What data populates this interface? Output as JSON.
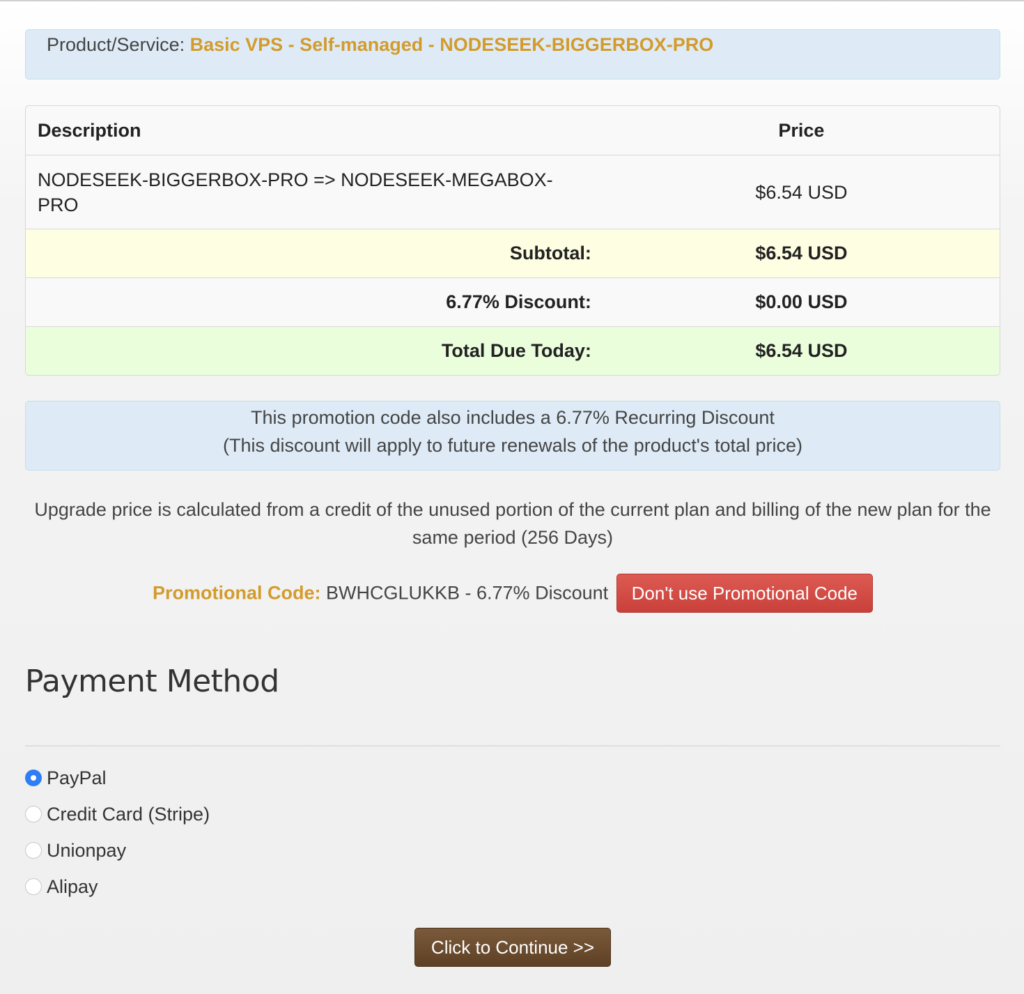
{
  "product": {
    "label": "Product/Service:",
    "name": "Basic VPS - Self-managed - NODESEEK-BIGGERBOX-PRO"
  },
  "summary": {
    "headers": {
      "description": "Description",
      "price": "Price"
    },
    "item": {
      "description": "NODESEEK-BIGGERBOX-PRO => NODESEEK-MEGABOX-PRO",
      "price": "$6.54 USD"
    },
    "subtotal": {
      "label": "Subtotal:",
      "value": "$6.54 USD"
    },
    "discount": {
      "label": "6.77% Discount:",
      "value": "$0.00 USD"
    },
    "total": {
      "label": "Total Due Today:",
      "value": "$6.54 USD"
    }
  },
  "promo_info": {
    "line1": "This promotion code also includes a 6.77% Recurring Discount",
    "line2": "(This discount will apply to future renewals of the product's total price)"
  },
  "upgrade_note": "Upgrade price is calculated from a credit of the unused portion of the current plan and billing of the new plan for the same period (256 Days)",
  "promo_code": {
    "label": "Promotional Code:",
    "value": "BWHCGLUKKB - 6.77% Discount",
    "remove_button": "Don't use Promotional Code"
  },
  "payment": {
    "title": "Payment Method",
    "methods": [
      {
        "label": "PayPal",
        "selected": true
      },
      {
        "label": "Credit Card (Stripe)",
        "selected": false
      },
      {
        "label": "Unionpay",
        "selected": false
      },
      {
        "label": "Alipay",
        "selected": false
      }
    ]
  },
  "continue_button": "Click to Continue >>",
  "colors": {
    "accent_orange": "#d39b2c",
    "info_blue": "#deebf6",
    "danger_red": "#d9534f",
    "continue_brown": "#6b4c2e",
    "radio_selected": "#2f7ef6"
  }
}
